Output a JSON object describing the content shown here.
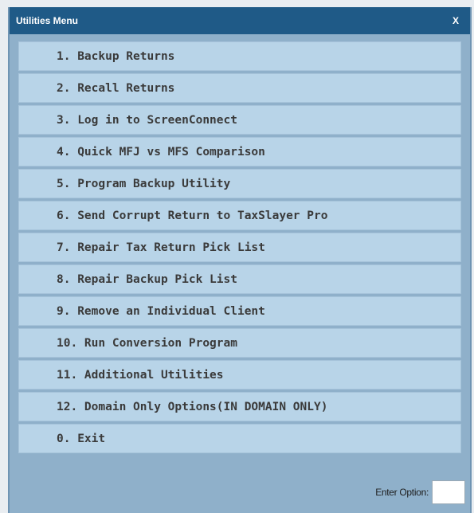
{
  "window": {
    "title": "Utilities Menu",
    "close_label": "X"
  },
  "menu": {
    "items": [
      {
        "label": "1. Backup Returns"
      },
      {
        "label": "2. Recall Returns"
      },
      {
        "label": "3. Log in to ScreenConnect"
      },
      {
        "label": "4. Quick MFJ vs MFS Comparison"
      },
      {
        "label": "5. Program Backup Utility"
      },
      {
        "label": "6. Send Corrupt Return to TaxSlayer Pro"
      },
      {
        "label": "7. Repair Tax Return Pick List"
      },
      {
        "label": "8. Repair Backup Pick List"
      },
      {
        "label": "9. Remove an Individual Client"
      },
      {
        "label": "10. Run Conversion Program"
      },
      {
        "label": "11. Additional Utilities"
      },
      {
        "label": "12. Domain Only Options(IN DOMAIN ONLY)"
      },
      {
        "label": "0. Exit"
      }
    ]
  },
  "footer": {
    "enter_option_label": "Enter Option:",
    "enter_option_value": ""
  },
  "colors": {
    "titlebar": "#1f5a87",
    "window_bg": "#8fb0ca",
    "menu_item_bg": "#b8d4e8"
  }
}
